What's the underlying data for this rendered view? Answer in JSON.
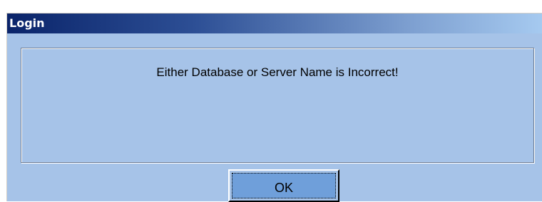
{
  "window": {
    "title": "Login"
  },
  "message": {
    "text": "Either Database or Server Name is Incorrect!"
  },
  "buttons": {
    "ok_label": "OK"
  },
  "colors": {
    "dialog_background": "#a6c3e8",
    "titlebar_start": "#0a246a",
    "titlebar_end": "#a6caf0",
    "title_text": "#ffffff",
    "button_face": "#6f9fda"
  }
}
